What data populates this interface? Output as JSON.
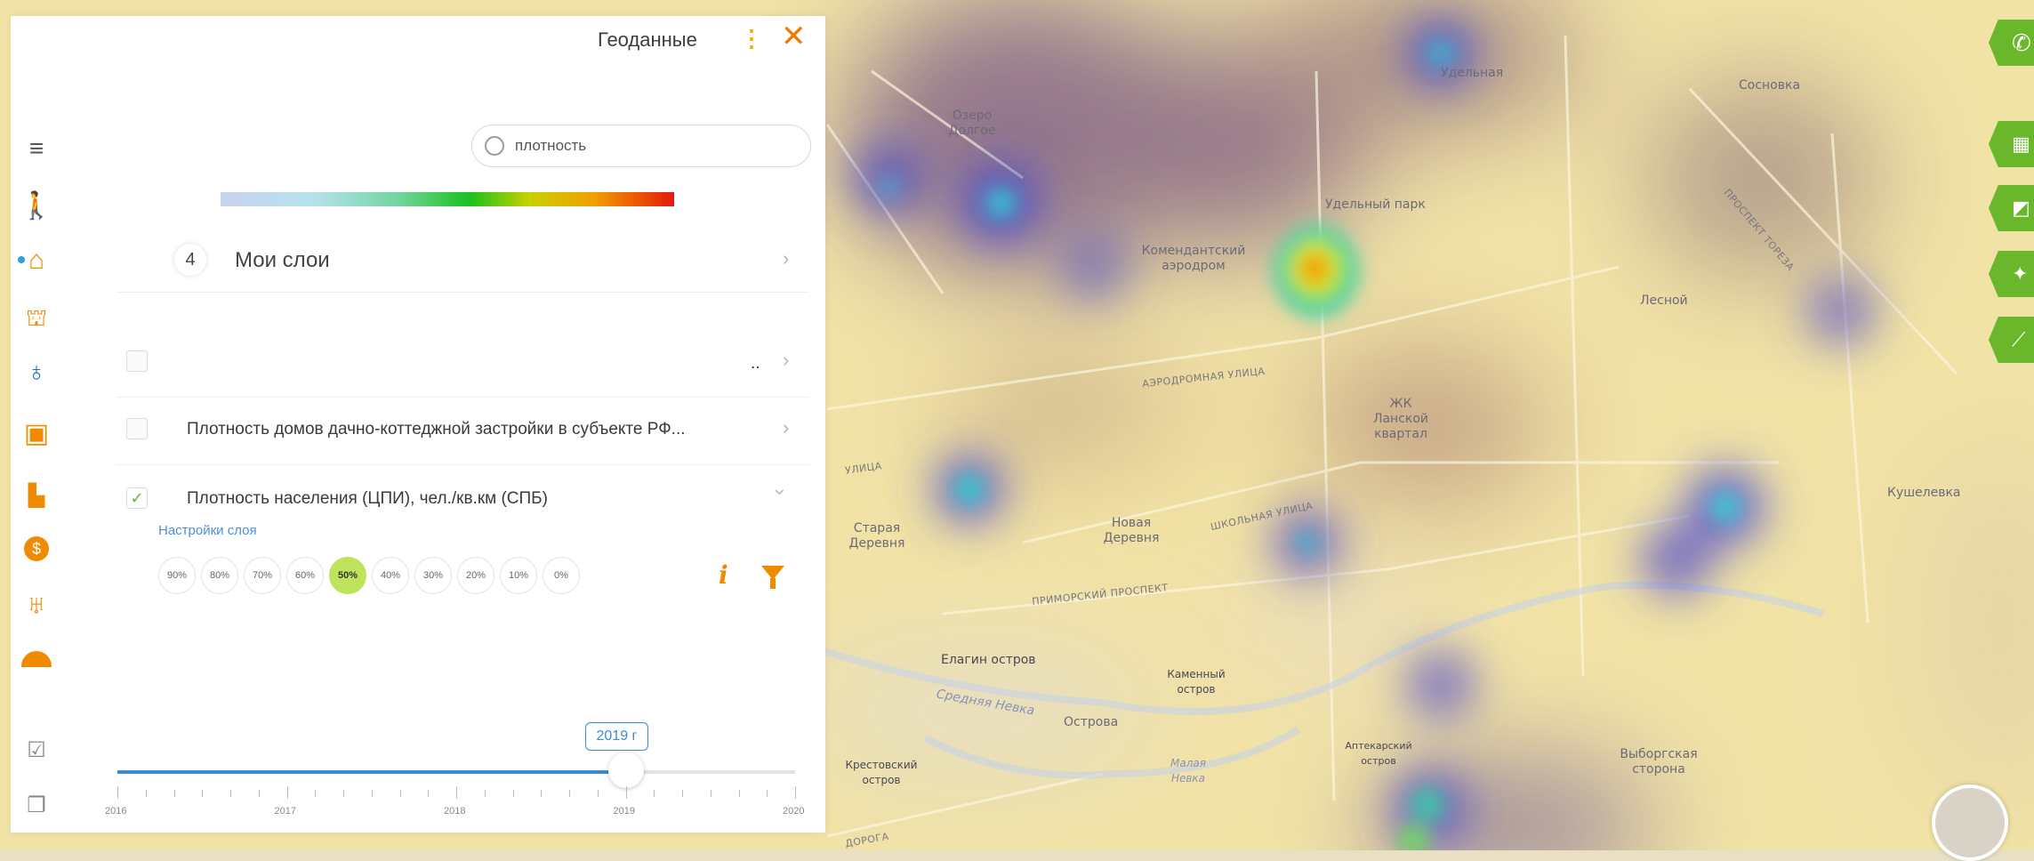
{
  "panel": {
    "title": "Геоданные",
    "search_value": "плотность",
    "my_layers": {
      "count": "4",
      "label": "Мои слои"
    },
    "layers": [
      {
        "label": "..",
        "checked": false
      },
      {
        "label": "Плотность домов дачно-коттеджной застройки в субъекте РФ...",
        "checked": false
      },
      {
        "label": "Плотность населения (ЦПИ), чел./кв.км (СПБ)",
        "checked": true
      }
    ],
    "layer_settings_label": "Настройки слоя",
    "opacity_options": [
      "90%",
      "80%",
      "70%",
      "60%",
      "50%",
      "40%",
      "30%",
      "20%",
      "10%",
      "0%"
    ],
    "opacity_selected": "50%",
    "timeline": {
      "years": [
        "2016",
        "2017",
        "2018",
        "2019",
        "2020"
      ],
      "selected_label": "2019 г",
      "selected_fraction": 0.75
    }
  },
  "map_labels": [
    "Озеро Долгое",
    "Удельная",
    "Сосновка",
    "Удельный парк",
    "Комендантский аэродром",
    "Лесной",
    "АЭРОДРОМНАЯ УЛИЦА",
    "ЖК Ланской квартал",
    "Новая Деревня",
    "Старая Деревня",
    "ШКОЛЬНАЯ УЛИЦА",
    "ПРИМОРСКИЙ ПРОСПЕКТ",
    "Кушелевка",
    "Елагин остров",
    "Каменный остров",
    "Средняя Невка",
    "Острова",
    "Малая Невка",
    "Аптекарский остров",
    "Выборгская сторона",
    "Крестовский остров",
    "ПРОСПЕКТ ТОРЕЗА",
    "УЛИЦА",
    "ДОРОГА"
  ],
  "icons": {
    "sidebar": [
      "menu-icon",
      "person-icon",
      "house-icon",
      "money-house-icon",
      "flask-icon",
      "bus-icon",
      "city-icon",
      "coin-icon",
      "eagle-icon",
      "ofo-icon",
      "layers-check-icon",
      "layers-icon"
    ],
    "right": [
      "phone-icon",
      "traffic-light-icon",
      "eraser-icon",
      "handshake-icon",
      "chart-icon"
    ]
  },
  "colors": {
    "accent_orange": "#f08a00",
    "green": "#6ab72c",
    "blue": "#3c8ad6"
  }
}
